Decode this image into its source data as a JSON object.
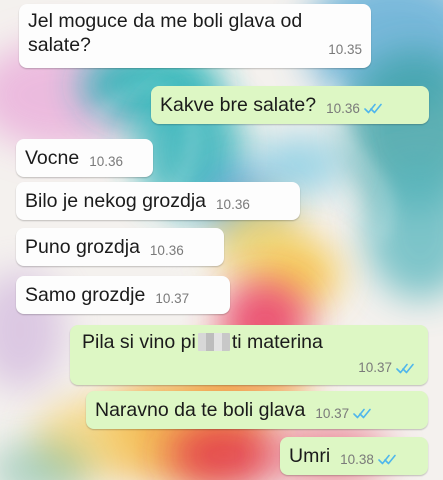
{
  "chat": {
    "messages": [
      {
        "direction": "incoming",
        "text": "Jel moguce da me boli glava od salate?",
        "time": "10.35"
      },
      {
        "direction": "outgoing",
        "text": "Kakve bre salate?",
        "time": "10.36",
        "status": "read"
      },
      {
        "direction": "incoming",
        "text": "Vocne",
        "time": "10.36"
      },
      {
        "direction": "incoming",
        "text": "Bilo je nekog grozdja",
        "time": "10.36"
      },
      {
        "direction": "incoming",
        "text": "Puno grozdja",
        "time": "10.36"
      },
      {
        "direction": "incoming",
        "text": "Samo grozdje",
        "time": "10.37"
      },
      {
        "direction": "outgoing",
        "text_before": "Pila si vino pi",
        "text_after": "ti materina",
        "censored": true,
        "time": "10.37",
        "status": "read"
      },
      {
        "direction": "outgoing",
        "text": "Naravno da te boli glava",
        "time": "10.37",
        "status": "read"
      },
      {
        "direction": "outgoing",
        "text": "Umri",
        "time": "10.38",
        "status": "read"
      }
    ]
  },
  "colors": {
    "incoming_bubble": "#fdfdfd",
    "outgoing_bubble": "#ddf7c4",
    "read_ticks": "#4fb6ec",
    "timestamp": "#7a7a7a"
  },
  "icons": {
    "read_status": "double-check-icon"
  }
}
